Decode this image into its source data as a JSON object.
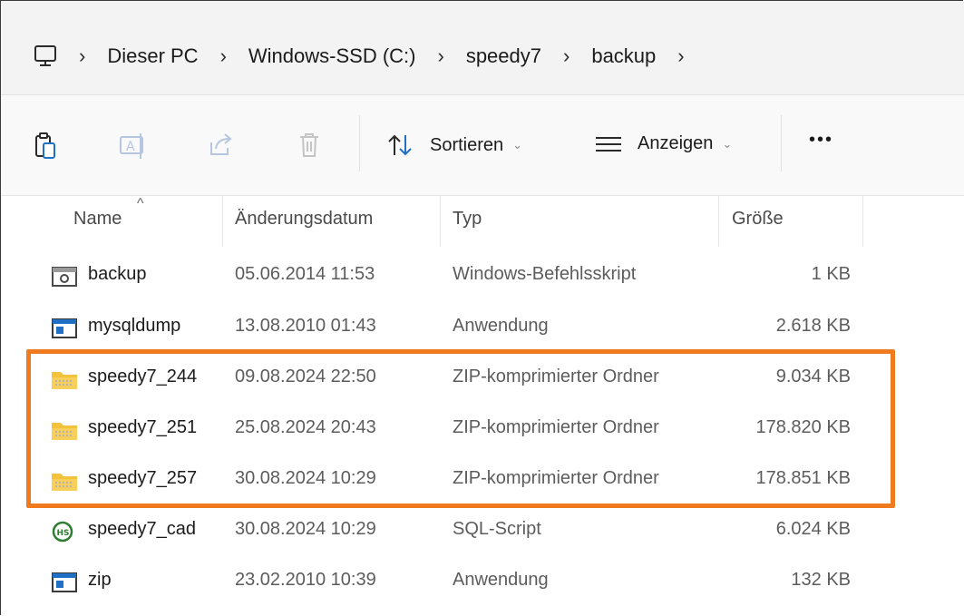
{
  "address_bar": {
    "breadcrumbs": [
      "Dieser PC",
      "Windows-SSD (C:)",
      "speedy7",
      "backup"
    ]
  },
  "toolbar": {
    "sort_label": "Sortieren",
    "view_label": "Anzeigen",
    "more_label": "•••"
  },
  "columns": {
    "name": "Name",
    "date": "Änderungsdatum",
    "type": "Typ",
    "size": "Größe"
  },
  "files": [
    {
      "name": "backup",
      "date": "05.06.2014 11:53",
      "type": "Windows-Befehlsskript",
      "size": "1 KB",
      "icon": "batch-script-icon"
    },
    {
      "name": "mysqldump",
      "date": "13.08.2010 01:43",
      "type": "Anwendung",
      "size": "2.618 KB",
      "icon": "application-icon"
    },
    {
      "name": "speedy7_244",
      "date": "09.08.2024 22:50",
      "type": "ZIP-komprimierter Ordner",
      "size": "9.034 KB",
      "icon": "zip-folder-icon"
    },
    {
      "name": "speedy7_251",
      "date": "25.08.2024 20:43",
      "type": "ZIP-komprimierter Ordner",
      "size": "178.820 KB",
      "icon": "zip-folder-icon"
    },
    {
      "name": "speedy7_257",
      "date": "30.08.2024 10:29",
      "type": "ZIP-komprimierter Ordner",
      "size": "178.851 KB",
      "icon": "zip-folder-icon"
    },
    {
      "name": "speedy7_cad",
      "date": "30.08.2024 10:29",
      "type": "SQL-Script",
      "size": "6.024 KB",
      "icon": "sql-script-icon"
    },
    {
      "name": "zip",
      "date": "23.02.2010 10:39",
      "type": "Anwendung",
      "size": "132 KB",
      "icon": "application-icon"
    }
  ],
  "colors": {
    "highlight": "#f07b1e",
    "zip_folder": "#f3c23c",
    "app_blue": "#1f6fc5"
  }
}
